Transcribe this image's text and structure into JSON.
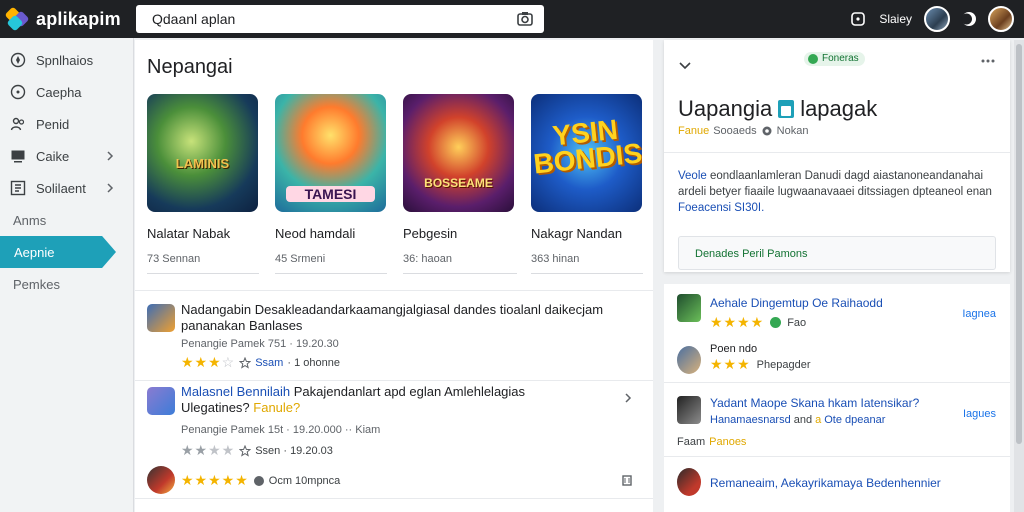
{
  "header": {
    "app_name": "aplikapim",
    "search_value": "Qdaanl aplan",
    "signin_label": "Slaiey"
  },
  "sidebar": {
    "items": [
      {
        "label": "Spnlhaios",
        "icon": "compass-icon",
        "chevron": false
      },
      {
        "label": "Caepha",
        "icon": "circle-icon",
        "chevron": false
      },
      {
        "label": "Penid",
        "icon": "people-icon",
        "chevron": false
      },
      {
        "label": "Caike",
        "icon": "monitor-icon",
        "chevron": true
      },
      {
        "label": "Solilaent",
        "icon": "grid-icon",
        "chevron": true
      }
    ],
    "plain_items": [
      "Anms",
      "Aepnie",
      "Pemkes"
    ],
    "active_index": 1
  },
  "main": {
    "section_title": "Nepangai",
    "cards": [
      {
        "thumb_text": "LAMINIS",
        "name": "Nalatar Nabak",
        "meta": "73 Sennan"
      },
      {
        "thumb_text": "TAMESI",
        "name": "Neod hamdali",
        "meta": "45 Srmeni"
      },
      {
        "thumb_text": "BOSSEAME",
        "name": "Pebgesin",
        "meta": "36: haoan"
      },
      {
        "thumb_text": "YSIN BONDIS",
        "name": "Nakagr Nandan",
        "meta": "363 hinan"
      }
    ],
    "list": [
      {
        "title_a": "Nadangabin Desakleadandarkaamangjalgiasal dandes tioalanl daikecjam",
        "title_b": "pananakan Banlases",
        "meta": "Penangie Pamek 751 · 19.20.30",
        "stars": "★★★",
        "stars_off": "☆",
        "sub_blue": "Ssam",
        "sub_text": "· 1 ohonne"
      },
      {
        "title_blue": "Malasnel Bennilaih",
        "title_a": "Pakajendanlart apd eglan Amlehlelagias",
        "title_b": "Ulegatines?",
        "title_yellow": "Fanule?",
        "meta": "Penangie Pamek 15t · 19.20.000 ·· Kiam",
        "stars": "★★",
        "stars_off": "★★",
        "sub_text": "Ssen · 19.20.03"
      },
      {
        "stars": "★★★★★",
        "sub_text": "Ocm 10mpnca"
      }
    ]
  },
  "detail": {
    "badge": "Foneras",
    "title_a": "Uapangia",
    "title_b": "lapagak",
    "sub_yellow": "Fanue",
    "sub_text": "Sooaeds",
    "sub_text2": "Nokan",
    "desc_blue": "Veole",
    "desc_a": "eondlaanlamleran Danudi dagd aiastanoneandanahai",
    "desc_b": "ardeli betyer fiaaile lugwaanavaaei ditssiagen dpteaneol enan",
    "desc_blue2": "Foeacensi SI30I.",
    "box_text": "Denades Peril Pamons"
  },
  "reviews": [
    {
      "title": "Aehale Dingemtup Oe Raihaodd",
      "stars": "★★★★",
      "extra": "Fao",
      "action": "Iagnea"
    },
    {
      "title": "Poen ndo",
      "stars": "★★★",
      "extra": "Phepagder",
      "action": ""
    },
    {
      "title": "Yadant Maope Skana hkam Iatensikar?",
      "sub_blue": "Hanamaesnarsd",
      "sub_mid": "and",
      "sub_yellow": "a",
      "sub_rest": "Ote dpeanar",
      "meta_a": "Faam",
      "meta_yellow": "Panoes",
      "action": "Iagues"
    },
    {
      "title": "Remaneaim, Aekayrikamaya Bedenhennier",
      "action": ""
    }
  ]
}
